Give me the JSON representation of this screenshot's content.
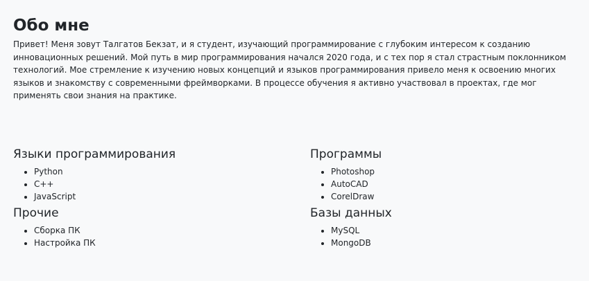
{
  "about": {
    "title": "Обо мне",
    "text": "Привет! Меня зовут Талгатов Бекзат, и я студент, изучающий программирование с глубоким интересом к созданию инновационных решений. Мой путь в мир программирования начался 2020 года, и с тех пор я стал страстным поклонником технологий. Мое стремление к изучению новых концепций и языков программирования привело меня к освоению многих языков и знакомству с современными фреймворками. В процессе обучения я активно участвовал в проектах, где мог применять свои знания на практике."
  },
  "sections": [
    {
      "title": "Языки программирования",
      "items": [
        "Python",
        "C++",
        "JavaScript"
      ]
    },
    {
      "title": "Программы",
      "items": [
        "Photoshop",
        "AutoCAD",
        "CorelDraw"
      ]
    },
    {
      "title": "Прочие",
      "items": [
        "Сборка ПК",
        "Настройка ПК"
      ]
    },
    {
      "title": "Базы данных",
      "items": [
        "MySQL",
        "MongoDB"
      ]
    }
  ]
}
